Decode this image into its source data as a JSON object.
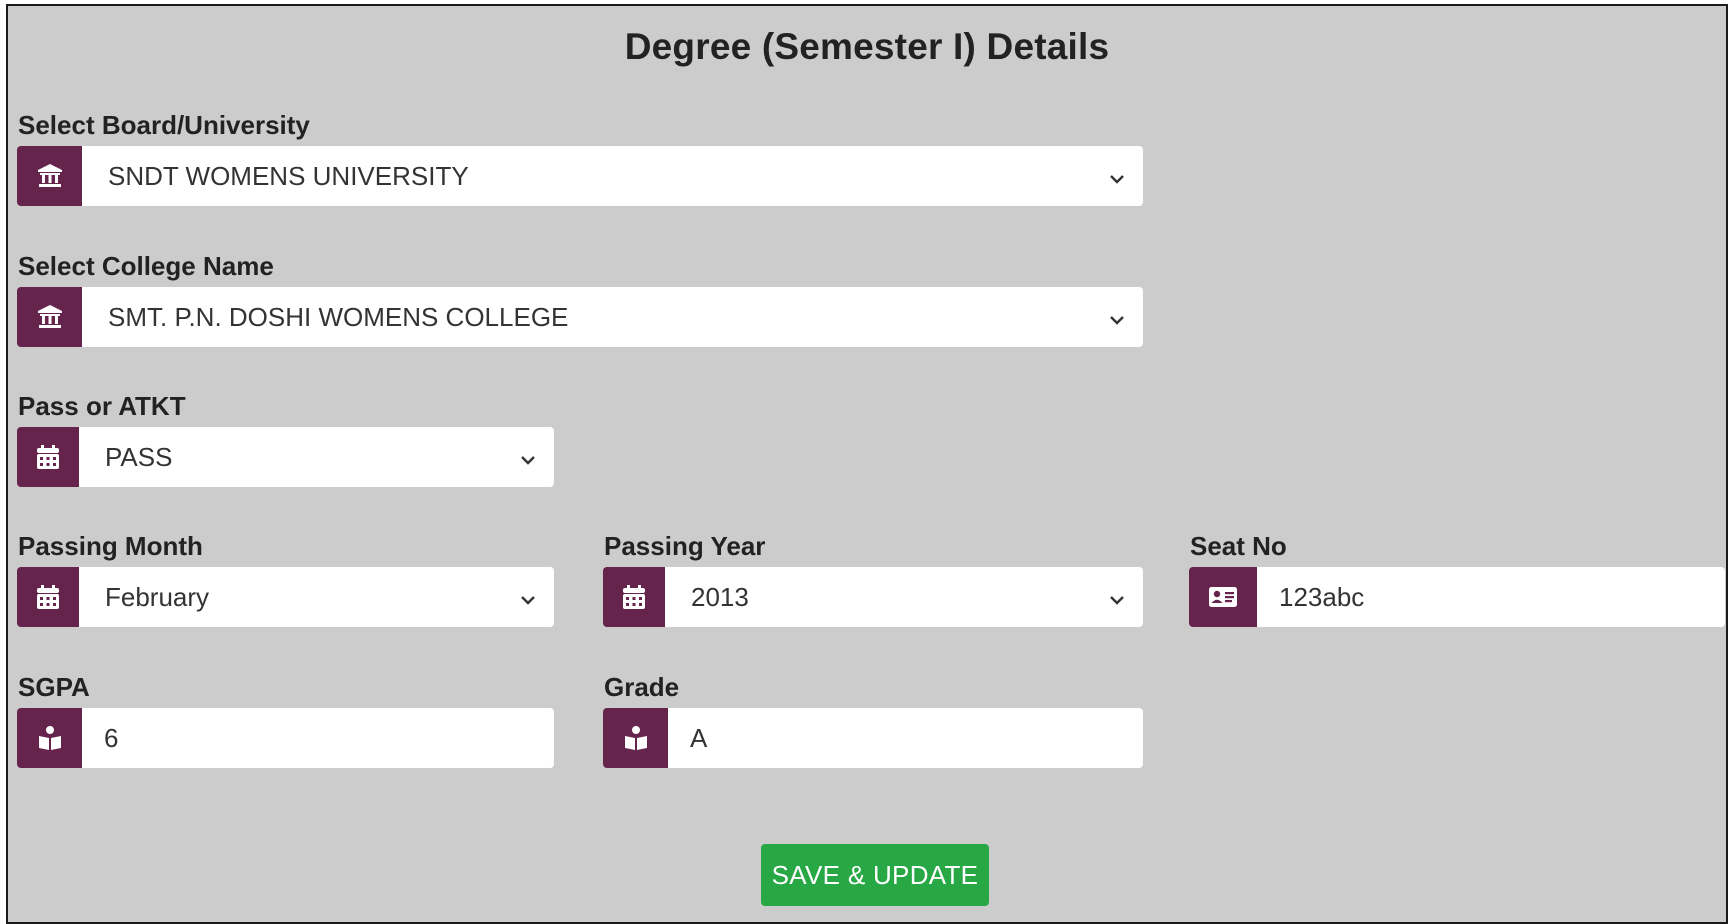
{
  "page": {
    "title": "Degree (Semester I) Details"
  },
  "board": {
    "label": "Select Board/University",
    "value": "SNDT WOMENS UNIVERSITY",
    "icon": "university-icon"
  },
  "college": {
    "label": "Select College Name",
    "value": "SMT. P.N. DOSHI WOMENS COLLEGE",
    "icon": "university-icon"
  },
  "pass_status": {
    "label": "Pass or ATKT",
    "value": "PASS",
    "icon": "calendar-icon"
  },
  "passing_month": {
    "label": "Passing Month",
    "value": "February",
    "icon": "calendar-icon"
  },
  "passing_year": {
    "label": "Passing Year",
    "value": "2013",
    "icon": "calendar-icon"
  },
  "seat_no": {
    "label": "Seat No",
    "value": "123abc",
    "icon": "id-card-icon"
  },
  "sgpa": {
    "label": "SGPA",
    "value": "6",
    "icon": "book-reader-icon"
  },
  "grade": {
    "label": "Grade",
    "value": "A",
    "icon": "book-reader-icon"
  },
  "actions": {
    "save_label": "SAVE & UPDATE"
  },
  "colors": {
    "panel_background": "#cccccc",
    "addon_background": "#65244c",
    "button_background": "#28a745"
  }
}
